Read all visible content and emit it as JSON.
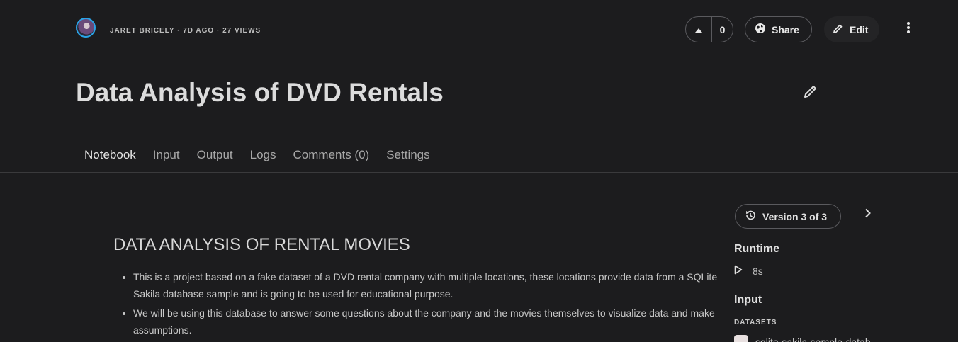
{
  "header": {
    "author": "JARET BRICELY",
    "meta_text": "JARET BRICELY · 7D AGO · 27 VIEWS",
    "vote_count": "0",
    "share_label": "Share",
    "edit_label": "Edit"
  },
  "title": "Data Analysis of DVD Rentals",
  "tabs": [
    {
      "label": "Notebook",
      "active": true
    },
    {
      "label": "Input"
    },
    {
      "label": "Output"
    },
    {
      "label": "Logs"
    },
    {
      "label": "Comments (0)"
    },
    {
      "label": "Settings"
    }
  ],
  "notebook": {
    "heading": "DATA ANALYSIS OF RENTAL MOVIES",
    "bullets": [
      "This is a project based on a fake dataset of a DVD rental company with multiple locations, these locations provide data from a SQLite Sakila database sample and is going to be used for educational purpose.",
      "We will be using this database to answer some questions about the company and the movies themselves to visualize data and make assumptions."
    ]
  },
  "sidebar": {
    "version_label": "Version 3 of 3",
    "runtime_heading": "Runtime",
    "runtime_value": "8s",
    "input_heading": "Input",
    "datasets_label": "DATASETS",
    "dataset_name": "sqlite-sakila-sample-datab..."
  },
  "icons": [
    "avatar",
    "upvote-icon",
    "globe-icon",
    "pencil-icon",
    "more-vertical-icon",
    "history-icon",
    "chevron-right-icon",
    "play-icon"
  ],
  "colors": {
    "background": "#1c1c1e",
    "avatar_ring": "#2aa4e8",
    "border": "#5a5a5e"
  }
}
